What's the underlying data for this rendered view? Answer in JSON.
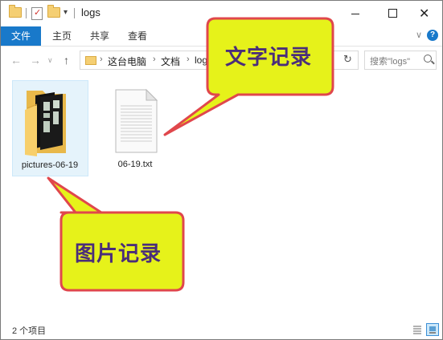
{
  "window": {
    "title": "logs"
  },
  "ribbon": {
    "tabs": [
      "文件",
      "主页",
      "共享",
      "查看"
    ]
  },
  "nav": {
    "breadcrumb": [
      "这台电脑",
      "文档",
      "logs"
    ],
    "search_placeholder": "搜索\"logs\""
  },
  "files": [
    {
      "name": "pictures-06-19",
      "type": "folder",
      "selected": true
    },
    {
      "name": "06-19.txt",
      "type": "text-file",
      "selected": false
    }
  ],
  "callouts": {
    "text_log": "文字记录",
    "picture_log": "图片记录"
  },
  "status": {
    "item_count": "2 个项目"
  },
  "colors": {
    "accent": "#1979ca",
    "callout_fill": "#e6f21a",
    "callout_border": "#e0474c",
    "callout_text": "#4a2d7a"
  }
}
